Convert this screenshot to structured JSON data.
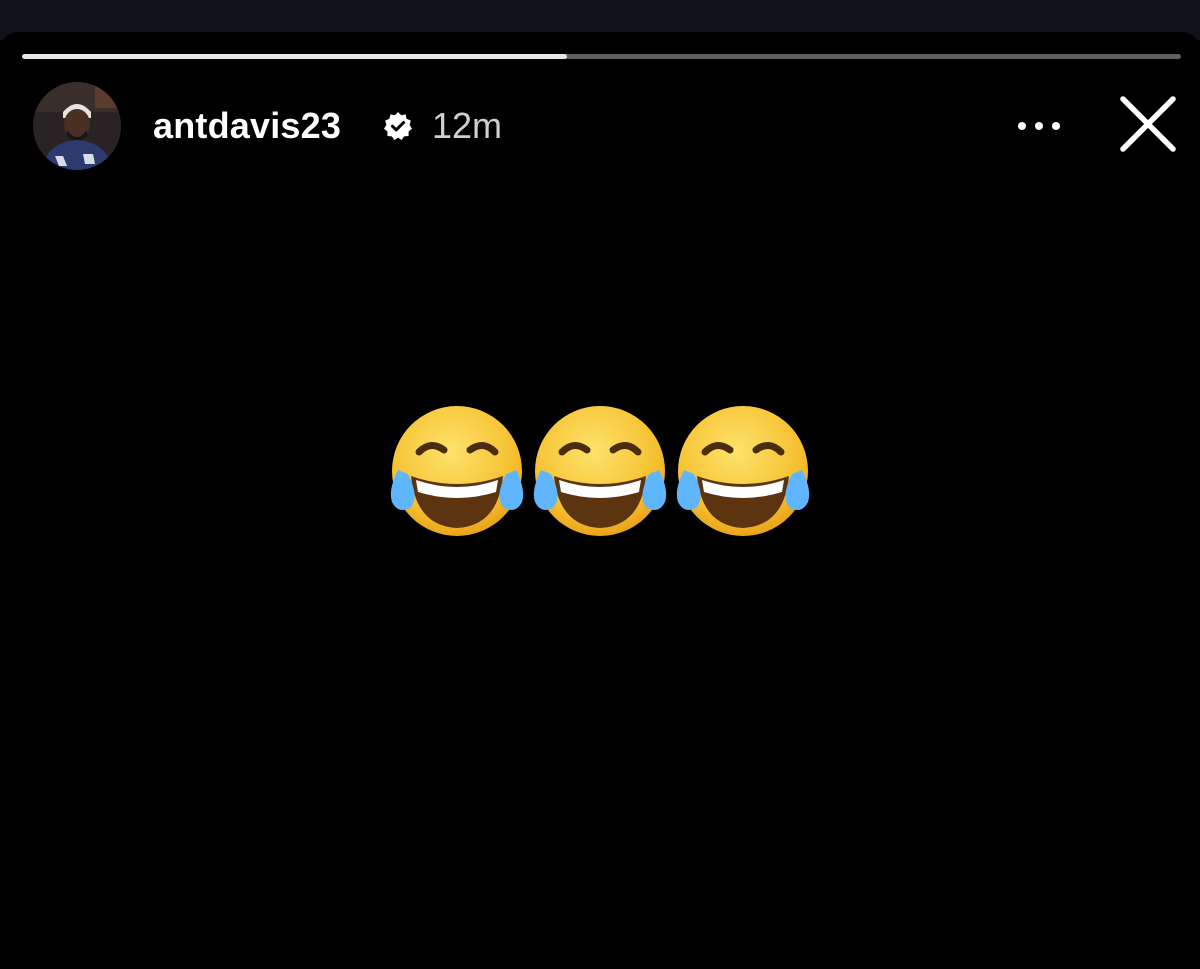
{
  "story": {
    "progress": 0.47,
    "user": {
      "username": "antdavis23",
      "verified": true,
      "avatar_icon": "profile-photo"
    },
    "posted_ago": "12m",
    "actions": {
      "more_icon": "more-horizontal-icon",
      "close_icon": "close-icon"
    },
    "content": {
      "emojis": [
        "😂",
        "😂",
        "😂"
      ],
      "emoji_name": "face-with-tears-of-joy"
    }
  },
  "colors": {
    "background": "#000000",
    "progress_track": "#5f5f5f",
    "progress_fill": "#e6e6e6",
    "text": "#ffffff",
    "emoji_face": "#f9c232",
    "emoji_tears": "#4fa8ff"
  }
}
